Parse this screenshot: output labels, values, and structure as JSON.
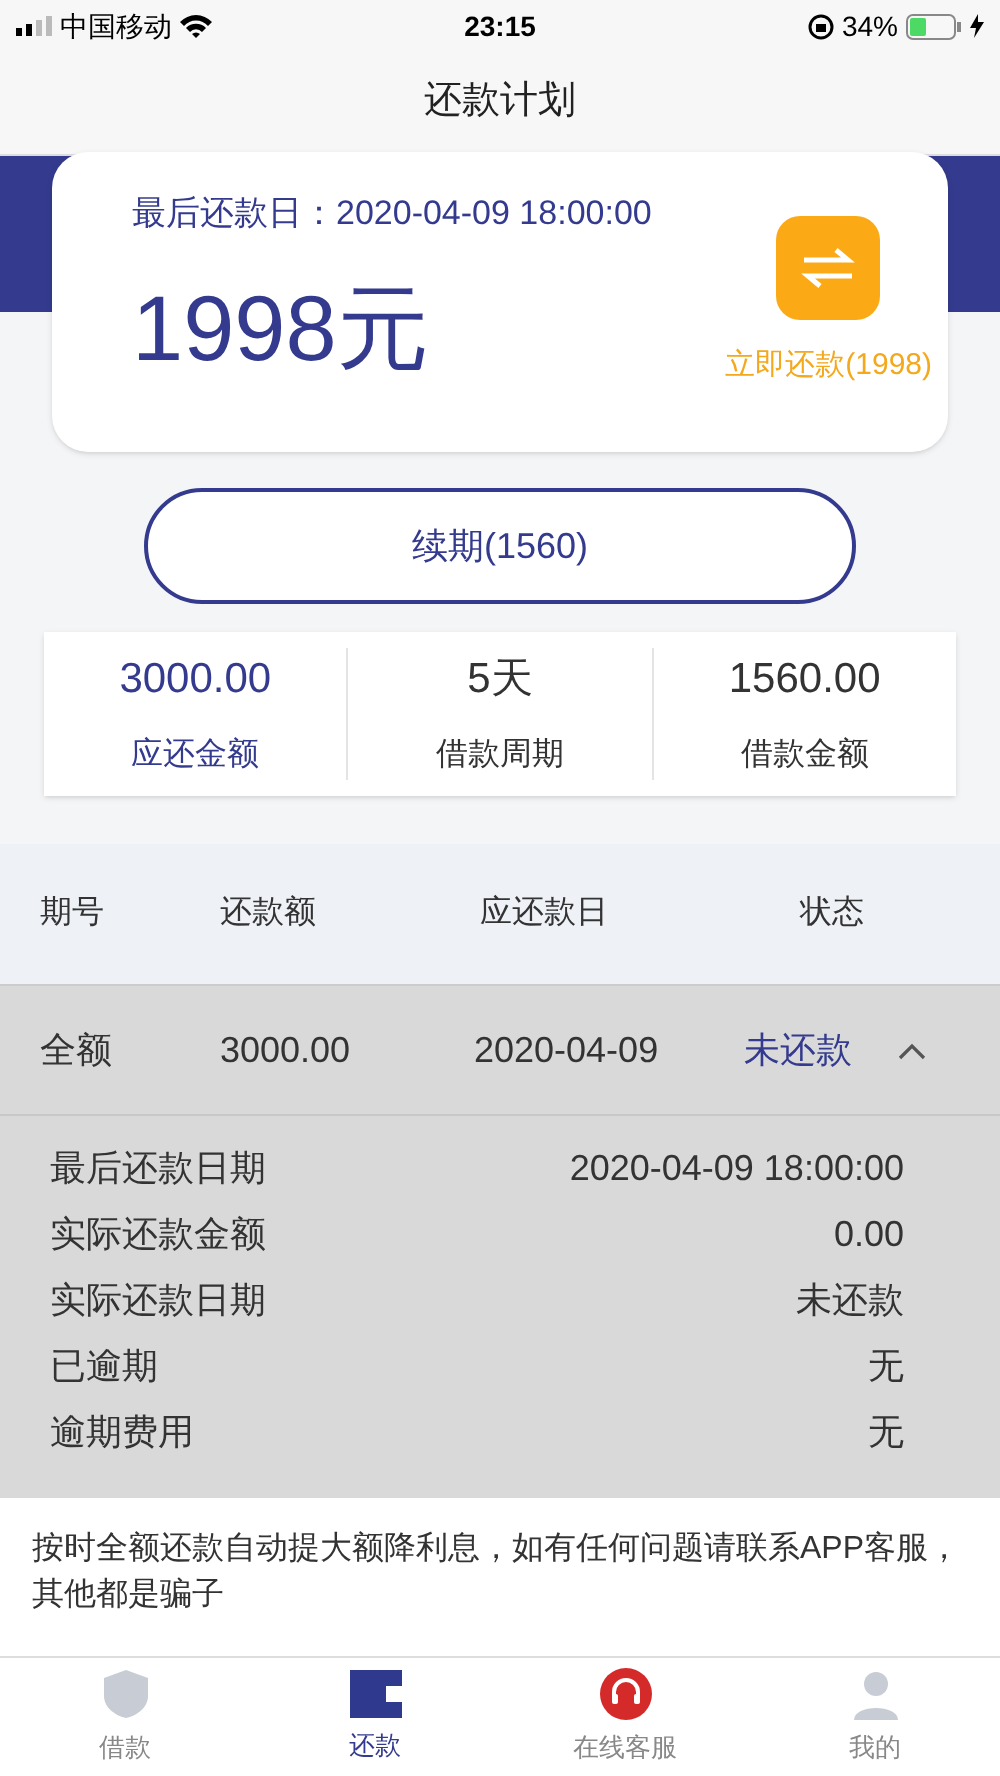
{
  "status_bar": {
    "carrier": "中国移动",
    "time": "23:15",
    "battery": "34%"
  },
  "nav": {
    "title": "还款计划"
  },
  "due_card": {
    "label": "最后还款日：2020-04-09 18:00:00",
    "amount": "1998元",
    "action": "立即还款(1998)"
  },
  "renew_button": "续期(1560)",
  "summary": [
    {
      "value": "3000.00",
      "label": "应还金额",
      "highlight": true
    },
    {
      "value": "5天",
      "label": "借款周期",
      "highlight": false
    },
    {
      "value": "1560.00",
      "label": "借款金额",
      "highlight": false
    }
  ],
  "table": {
    "columns": [
      "期号",
      "还款额",
      "应还款日",
      "状态"
    ],
    "rows": [
      {
        "period": "全额",
        "amount": "3000.00",
        "date": "2020-04-09",
        "status": "未还款",
        "expanded": true,
        "details": [
          {
            "label": "最后还款日期",
            "value": "2020-04-09 18:00:00"
          },
          {
            "label": "实际还款金额",
            "value": "0.00"
          },
          {
            "label": "实际还款日期",
            "value": "未还款"
          },
          {
            "label": "已逾期",
            "value": "无"
          },
          {
            "label": "逾期费用",
            "value": "无"
          }
        ]
      }
    ]
  },
  "notice": "按时全额还款自动提大额降利息，如有任何问题请联系APP客服，其他都是骗子",
  "tab_bar": [
    {
      "label": "借款",
      "kind": "loan",
      "selected": false
    },
    {
      "label": "还款",
      "kind": "repay",
      "selected": true
    },
    {
      "label": "在线客服",
      "kind": "service",
      "selected": false
    },
    {
      "label": "我的",
      "kind": "me",
      "selected": false
    }
  ]
}
